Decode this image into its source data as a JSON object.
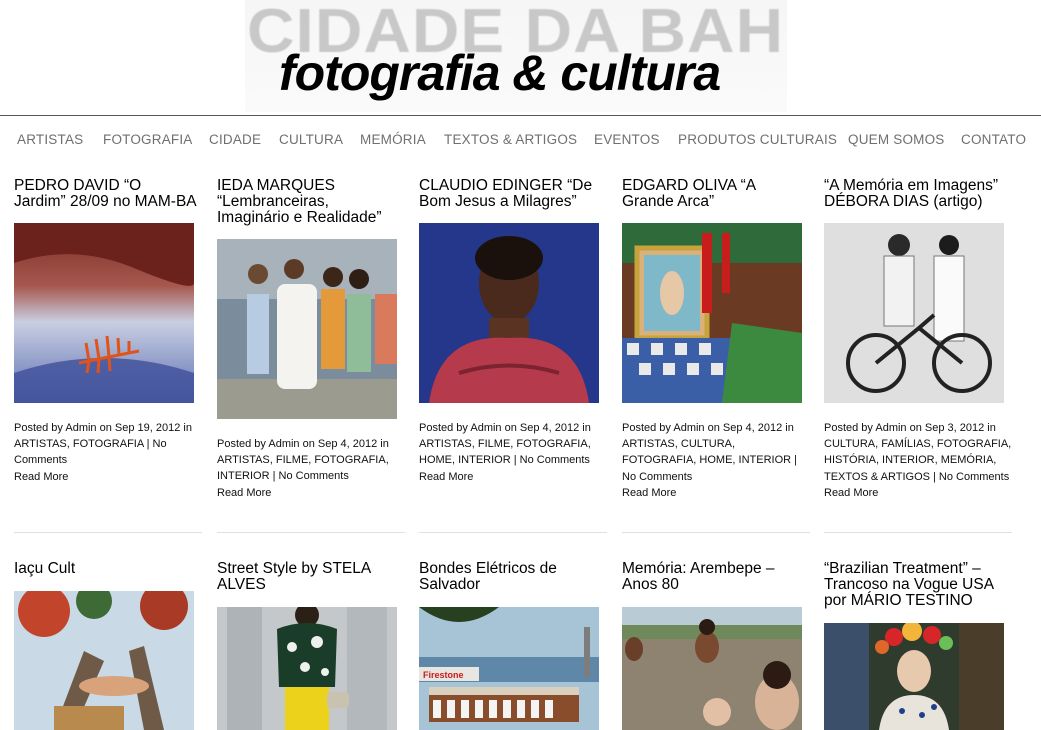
{
  "header": {
    "logo_background_text": "CIDADE DA BAHIA",
    "logo_text": "fotografia & cultura"
  },
  "nav": {
    "items": [
      "ARTISTAS",
      "FOTOGRAFIA",
      "CIDADE",
      "CULTURA",
      "MEMÓRIA",
      "TEXTOS & ARTIGOS",
      "EVENTOS",
      "PRODUTOS CULTURAIS",
      "QUEM SOMOS",
      "CONTATO"
    ]
  },
  "posts": [
    {
      "title_lines": [
        "PEDRO DAVID “O",
        "Jardim” 28/09 no MAM-BA"
      ],
      "meta_lines": [
        "Posted by Admin on Sep 19, 2012 in",
        "ARTISTAS, FOTOGRAFIA | No",
        "Comments"
      ],
      "read_more": "Read More"
    },
    {
      "title_lines": [
        "IEDA MARQUES",
        "“Lembranceiras,",
        "Imaginário e Realidade”"
      ],
      "meta_lines": [
        "Posted by Admin on Sep 4, 2012 in",
        "ARTISTAS, FILME, FOTOGRAFIA,",
        "INTERIOR | No Comments"
      ],
      "read_more": "Read More"
    },
    {
      "title_lines": [
        "CLAUDIO EDINGER “De",
        "Bom Jesus a Milagres”"
      ],
      "meta_lines": [
        "Posted by Admin on Sep 4, 2012 in",
        "ARTISTAS, FILME, FOTOGRAFIA,",
        "HOME, INTERIOR | No Comments"
      ],
      "read_more": "Read More"
    },
    {
      "title_lines": [
        "EDGARD OLIVA “A",
        "Grande Arca”"
      ],
      "meta_lines": [
        "Posted by Admin on Sep 4, 2012 in",
        "ARTISTAS, CULTURA,",
        "FOTOGRAFIA, HOME, INTERIOR |",
        "No Comments"
      ],
      "read_more": "Read More"
    },
    {
      "title_lines": [
        "“A Memória em Imagens”",
        "DÉBORA DIAS (artigo)"
      ],
      "meta_lines": [
        "Posted by Admin on Sep 3, 2012 in",
        "CULTURA, FAMÍLIAS, FOTOGRAFIA,",
        "HISTÓRIA, INTERIOR, MEMÓRIA,",
        "TEXTOS & ARTIGOS | No Comments"
      ],
      "read_more": "Read More"
    },
    {
      "title_lines": [
        "Iaçu Cult"
      ]
    },
    {
      "title_lines": [
        "Street Style by STELA",
        "ALVES"
      ]
    },
    {
      "title_lines": [
        "Bondes Elétricos de",
        "Salvador"
      ]
    },
    {
      "title_lines": [
        "Memória: Arembepe –",
        "Anos 80"
      ]
    },
    {
      "title_lines": [
        "“Brazilian Treatment” –",
        "Trancoso na Vogue USA",
        "por MÁRIO TESTINO"
      ]
    }
  ],
  "photo_signs": {
    "firestone": "Firestone"
  }
}
